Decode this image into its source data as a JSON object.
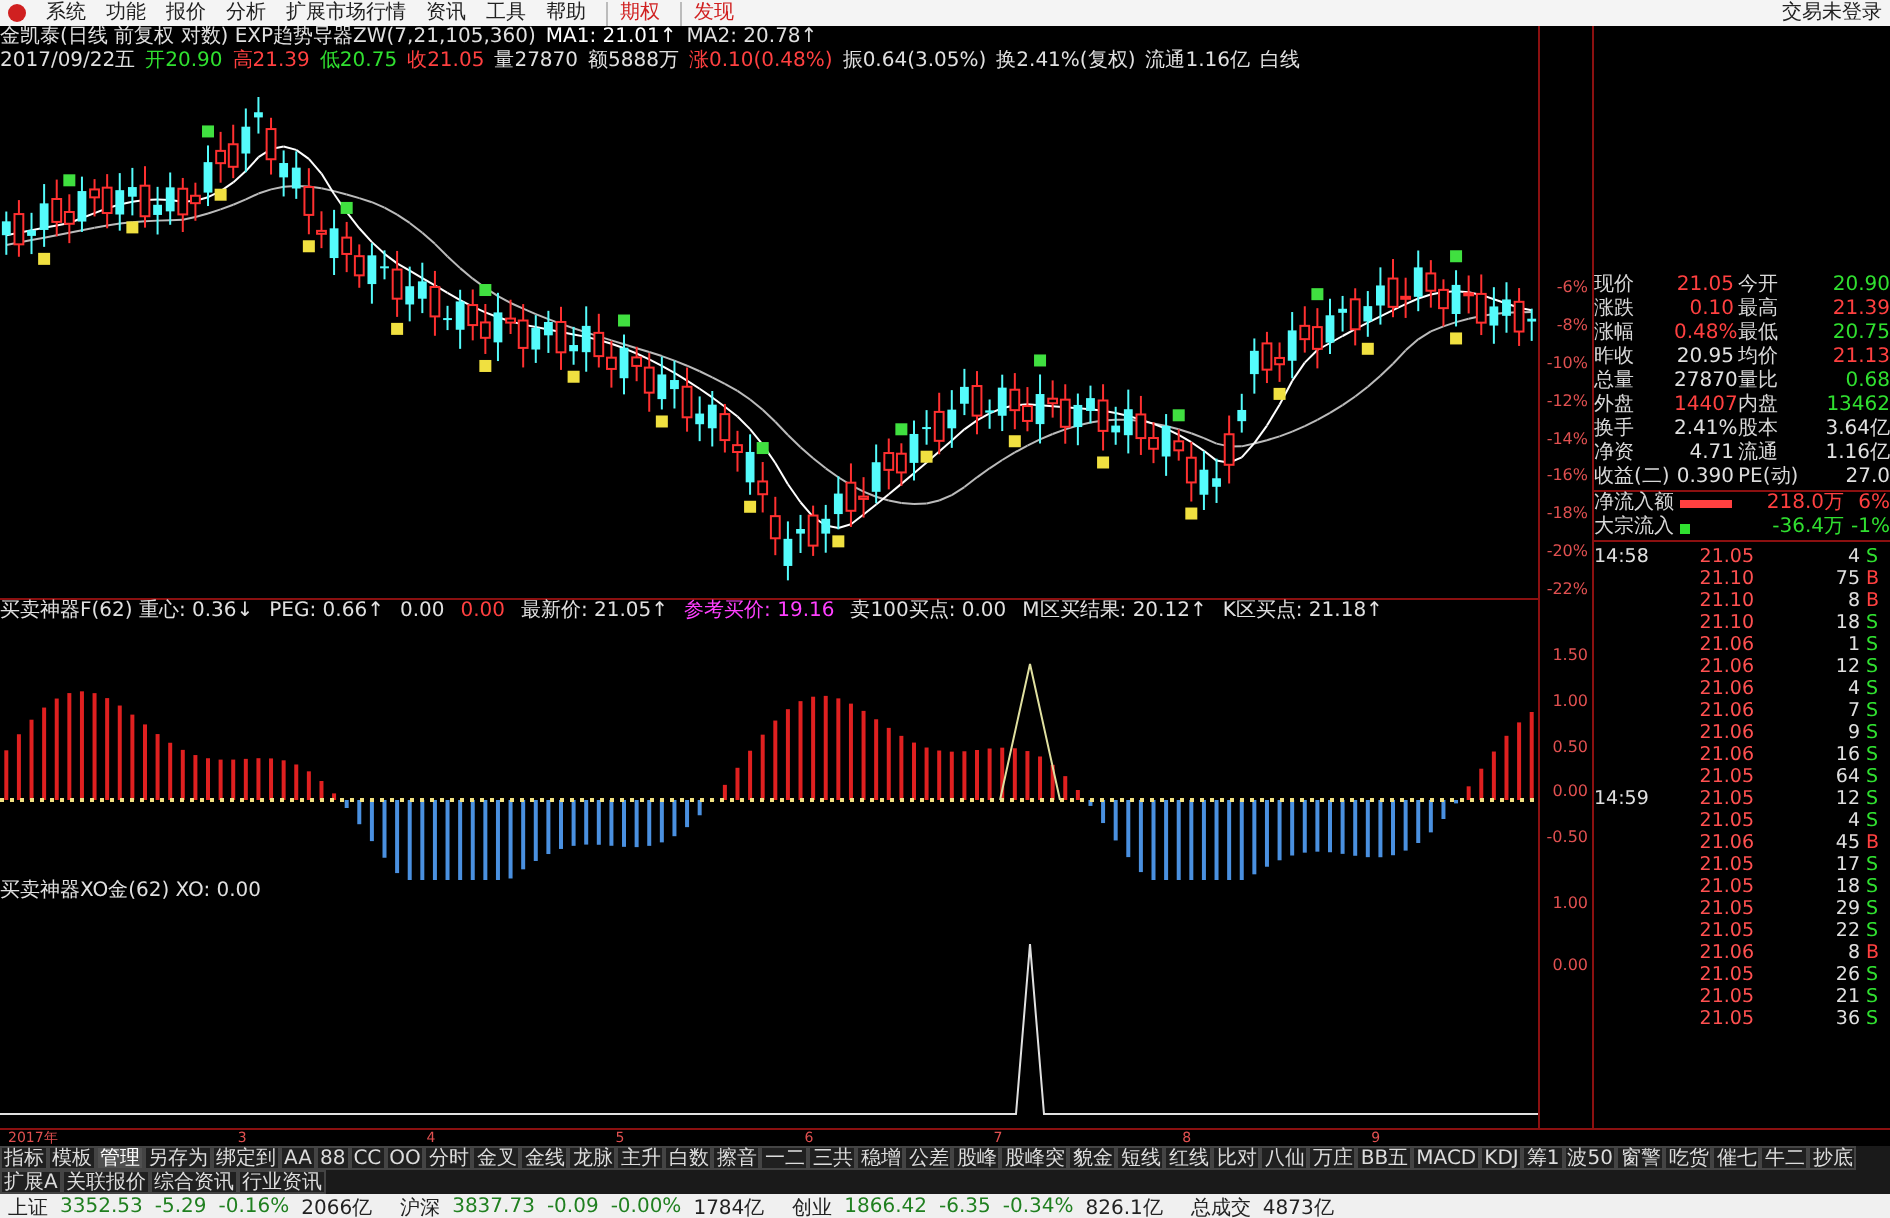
{
  "menu": [
    {
      "label": "系统",
      "kind": "plain"
    },
    {
      "label": "功能",
      "kind": "plain"
    },
    {
      "label": "报价",
      "kind": "plain"
    },
    {
      "label": "分析",
      "kind": "plain"
    },
    {
      "label": "扩展市场行情",
      "kind": "plain"
    },
    {
      "label": "资讯",
      "kind": "plain"
    },
    {
      "label": "工具",
      "kind": "plain"
    },
    {
      "label": "帮助",
      "kind": "plain"
    },
    {
      "label": "期权",
      "kind": "accent"
    },
    {
      "label": "发现",
      "kind": "accent"
    }
  ],
  "login": "交易未登录",
  "chart": {
    "header_lines": [
      [
        {
          "text": "金凯泰(日线 前复权 对数) EXP趋势导器ZW(7,21,105,360)",
          "color": "#e0e0e0"
        },
        {
          "text": "MA1: 21.01↑",
          "color": "#ffffff"
        },
        {
          "text": "MA2: 20.78↑",
          "color": "#e0e0e0"
        }
      ],
      [
        {
          "text": "2017/09/22五",
          "color": "#e0e0e0"
        },
        {
          "text": "开20.90",
          "color": "#30e030"
        },
        {
          "text": "高21.39",
          "color": "#ff4040"
        },
        {
          "text": "低20.75",
          "color": "#30e030"
        },
        {
          "text": "收21.05",
          "color": "#ff4040"
        },
        {
          "text": "量27870",
          "color": "#e0e0e0"
        },
        {
          "text": "额5888万",
          "color": "#e0e0e0"
        },
        {
          "text": "涨0.10(0.48%)",
          "color": "#ff4040"
        },
        {
          "text": "振0.64(3.05%)",
          "color": "#e0e0e0"
        },
        {
          "text": "换2.41%(复权)",
          "color": "#e0e0e0"
        },
        {
          "text": "流通1.16亿",
          "color": "#e0e0e0"
        },
        {
          "text": "白线",
          "color": "#e0e0e0"
        }
      ]
    ],
    "price_axis": [
      "-6%",
      "-8%",
      "-10%",
      "-12%",
      "-14%",
      "-16%",
      "-18%",
      "-20%",
      "-22%"
    ]
  },
  "indicator_1": {
    "header": [
      {
        "text": "买卖神器F(62) 重心: 0.36↓",
        "color": "#e0e0e0"
      },
      {
        "text": "PEG: 0.66↑",
        "color": "#e0e0e0"
      },
      {
        "text": "0.00",
        "color": "#e0e0e0"
      },
      {
        "text": "0.00",
        "color": "#ff4040"
      },
      {
        "text": "最新价: 21.05↑",
        "color": "#e0e0e0"
      },
      {
        "text": "参考买价: 19.16",
        "color": "#ff40ff"
      },
      {
        "text": "卖100买点: 0.00",
        "color": "#e0e0e0"
      },
      {
        "text": "M区买结果: 20.12↑",
        "color": "#e0e0e0"
      },
      {
        "text": "K区买点: 21.18↑",
        "color": "#e0e0e0"
      }
    ],
    "axis": [
      "1.50",
      "1.00",
      "0.50",
      "0.00",
      "-0.50"
    ]
  },
  "indicator_2": {
    "header": [
      {
        "text": "买卖神器XO金(62) XO: 0.00",
        "color": "#e0e0e0"
      }
    ],
    "axis": [
      "1.00",
      "0.00"
    ]
  },
  "quote": [
    {
      "cells": [
        {
          "label": "现价",
          "value": "21.05",
          "color": "#ff4040"
        },
        {
          "label": "今开",
          "value": "20.90",
          "color": "#30e030"
        }
      ]
    },
    {
      "cells": [
        {
          "label": "涨跌",
          "value": "0.10",
          "color": "#ff4040"
        },
        {
          "label": "最高",
          "value": "21.39",
          "color": "#ff4040"
        }
      ]
    },
    {
      "cells": [
        {
          "label": "涨幅",
          "value": "0.48%",
          "color": "#ff4040"
        },
        {
          "label": "最低",
          "value": "20.75",
          "color": "#30e030"
        }
      ]
    },
    {
      "cells": [
        {
          "label": "昨收",
          "value": "20.95",
          "color": "#e0e0e0"
        },
        {
          "label": "均价",
          "value": "21.13",
          "color": "#ff4040"
        }
      ]
    },
    {
      "cells": [
        {
          "label": "总量",
          "value": "27870",
          "color": "#e0e0e0"
        },
        {
          "label": "量比",
          "value": "0.68",
          "color": "#30e030"
        }
      ]
    },
    {
      "cells": [
        {
          "label": "外盘",
          "value": "14407",
          "color": "#ff4040"
        },
        {
          "label": "内盘",
          "value": "13462",
          "color": "#30e030"
        }
      ]
    },
    {
      "cells": [
        {
          "label": "换手",
          "value": "2.41%",
          "color": "#e0e0e0"
        },
        {
          "label": "股本",
          "value": "3.64亿",
          "color": "#e0e0e0"
        }
      ]
    },
    {
      "cells": [
        {
          "label": "净资",
          "value": "4.71",
          "color": "#e0e0e0"
        },
        {
          "label": "流通",
          "value": "1.16亿",
          "color": "#e0e0e0"
        }
      ]
    },
    {
      "cells": [
        {
          "label": "收益(二)",
          "value": "0.390",
          "color": "#e0e0e0"
        },
        {
          "label": "PE(动)",
          "value": "27.0",
          "color": "#e0e0e0"
        }
      ]
    }
  ],
  "flows": [
    {
      "label": "净流入额",
      "kind": "bar",
      "amount": "218.0万",
      "pct": "6%",
      "color": "#ff4040"
    },
    {
      "label": "大宗流入",
      "kind": "dot",
      "amount": "-36.4万",
      "pct": "-1%",
      "color": "#30e030"
    }
  ],
  "ticks": [
    {
      "time": "14:58",
      "price": "21.05",
      "volume": "4",
      "side": "S",
      "color": "#30e030"
    },
    {
      "price": "21.10",
      "volume": "75",
      "side": "B",
      "color": "#ff4040"
    },
    {
      "price": "21.10",
      "volume": "8",
      "side": "B",
      "color": "#ff4040"
    },
    {
      "price": "21.10",
      "volume": "18",
      "side": "S",
      "color": "#30e030"
    },
    {
      "price": "21.06",
      "volume": "1",
      "side": "S",
      "color": "#30e030"
    },
    {
      "price": "21.06",
      "volume": "12",
      "side": "S",
      "color": "#30e030"
    },
    {
      "price": "21.06",
      "volume": "4",
      "side": "S",
      "color": "#30e030"
    },
    {
      "price": "21.06",
      "volume": "7",
      "side": "S",
      "color": "#30e030"
    },
    {
      "price": "21.06",
      "volume": "9",
      "side": "S",
      "color": "#30e030"
    },
    {
      "price": "21.06",
      "volume": "16",
      "side": "S",
      "color": "#30e030"
    },
    {
      "price": "21.05",
      "volume": "64",
      "side": "S",
      "color": "#30e030"
    },
    {
      "time": "14:59",
      "price": "21.05",
      "volume": "12",
      "side": "S",
      "color": "#30e030"
    },
    {
      "price": "21.05",
      "volume": "4",
      "side": "S",
      "color": "#30e030"
    },
    {
      "price": "21.06",
      "volume": "45",
      "side": "B",
      "color": "#ff4040"
    },
    {
      "price": "21.05",
      "volume": "17",
      "side": "S",
      "color": "#30e030"
    },
    {
      "price": "21.05",
      "volume": "18",
      "side": "S",
      "color": "#30e030"
    },
    {
      "price": "21.05",
      "volume": "29",
      "side": "S",
      "color": "#30e030"
    },
    {
      "price": "21.05",
      "volume": "22",
      "side": "S",
      "color": "#30e030"
    },
    {
      "price": "21.06",
      "volume": "8",
      "side": "B",
      "color": "#ff4040"
    },
    {
      "price": "21.05",
      "volume": "26",
      "side": "S",
      "color": "#30e030"
    },
    {
      "price": "21.05",
      "volume": "21",
      "side": "S",
      "color": "#30e030"
    },
    {
      "price": "21.05",
      "volume": "36",
      "side": "S",
      "color": "#30e030"
    }
  ],
  "date_axis": [
    "2017年",
    "3",
    "4",
    "5",
    "6",
    "7",
    "8",
    "9"
  ],
  "toolbar": [
    {
      "label": "指标",
      "selected": false
    },
    {
      "label": "模板",
      "selected": false
    },
    {
      "label": "管理",
      "selected": true
    },
    {
      "label": "另存为",
      "selected": false
    },
    {
      "label": "绑定到",
      "selected": false
    },
    {
      "label": "AA",
      "selected": false
    },
    {
      "label": "88",
      "selected": false
    },
    {
      "label": "CC",
      "selected": false
    },
    {
      "label": "OO",
      "selected": false
    },
    {
      "label": "分时",
      "selected": false
    },
    {
      "label": "金叉",
      "selected": false
    },
    {
      "label": "金线",
      "selected": false
    },
    {
      "label": "龙脉",
      "selected": false
    },
    {
      "label": "主升",
      "selected": false
    },
    {
      "label": "白数",
      "selected": false
    },
    {
      "label": "擦音",
      "selected": false
    },
    {
      "label": "一二",
      "selected": false
    },
    {
      "label": "三共",
      "selected": false
    },
    {
      "label": "稳增",
      "selected": false
    },
    {
      "label": "公差",
      "selected": false
    },
    {
      "label": "股峰",
      "selected": false
    },
    {
      "label": "股峰突",
      "selected": false
    },
    {
      "label": "貌金",
      "selected": false
    },
    {
      "label": "短线",
      "selected": false
    },
    {
      "label": "红线",
      "selected": false
    },
    {
      "label": "比对",
      "selected": false
    },
    {
      "label": "八仙",
      "selected": false
    },
    {
      "label": "万庄",
      "selected": false
    },
    {
      "label": "BB五",
      "selected": false
    },
    {
      "label": "MACD",
      "selected": false
    },
    {
      "label": "KDJ",
      "selected": false
    },
    {
      "label": "筹1",
      "selected": false
    },
    {
      "label": "波50",
      "selected": false
    },
    {
      "label": "窗警",
      "selected": false
    },
    {
      "label": "吃货",
      "selected": false
    },
    {
      "label": "催七",
      "selected": false
    },
    {
      "label": "牛二",
      "selected": false
    },
    {
      "label": "抄底",
      "selected": false
    }
  ],
  "subtabs": [
    {
      "label": "扩展A",
      "selected": false
    },
    {
      "label": "关联报价",
      "selected": false
    },
    {
      "label": "综合资讯",
      "selected": false
    },
    {
      "label": "行业资讯",
      "selected": false
    }
  ],
  "status_bar": [
    {
      "name": "上证",
      "value": "3352.53",
      "change": "-5.29",
      "pct": "-0.16%",
      "amount": "2066亿"
    },
    {
      "name": "沪深",
      "value": "3837.73",
      "change": "-0.09",
      "pct": "-0.00%",
      "amount": "1784亿"
    },
    {
      "name": "创业",
      "value": "1866.42",
      "change": "-6.35",
      "pct": "-0.34%",
      "amount": "826.1亿"
    },
    {
      "name": "总成交",
      "amount": "4873亿"
    }
  ]
}
